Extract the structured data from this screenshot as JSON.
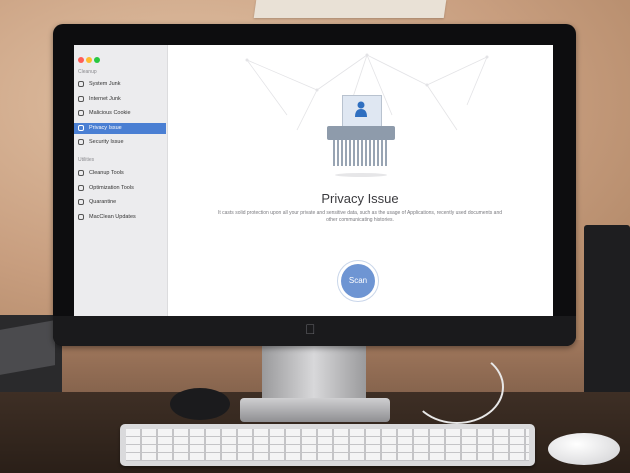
{
  "window": {
    "traffic_lights": [
      "#ff5f57",
      "#febc2e",
      "#28c840"
    ]
  },
  "sidebar": {
    "sections": [
      {
        "label": "Cleanup",
        "items": [
          {
            "label": "System Junk",
            "icon": "trash-icon"
          },
          {
            "label": "Internet Junk",
            "icon": "globe-icon"
          },
          {
            "label": "Malicious Cookie",
            "icon": "cookie-icon"
          },
          {
            "label": "Privacy Issue",
            "icon": "privacy-icon",
            "active": true
          },
          {
            "label": "Security Issue",
            "icon": "shield-icon"
          }
        ]
      },
      {
        "label": "Utilities",
        "items": [
          {
            "label": "Cleanup Tools",
            "icon": "tools-icon"
          },
          {
            "label": "Optimization Tools",
            "icon": "speed-icon"
          },
          {
            "label": "Quarantine",
            "icon": "quarantine-icon"
          },
          {
            "label": "MacClean Updates",
            "icon": "update-icon"
          }
        ]
      }
    ]
  },
  "main": {
    "title": "Privacy Issue",
    "description": "It casts solid protection upon all your private and sensitive data, such as the usage of Applications, recently used documents and other communicating histories.",
    "scan_label": "Scan"
  },
  "colors": {
    "accent": "#4a7fd3",
    "scan_button": "#6e95d3"
  }
}
